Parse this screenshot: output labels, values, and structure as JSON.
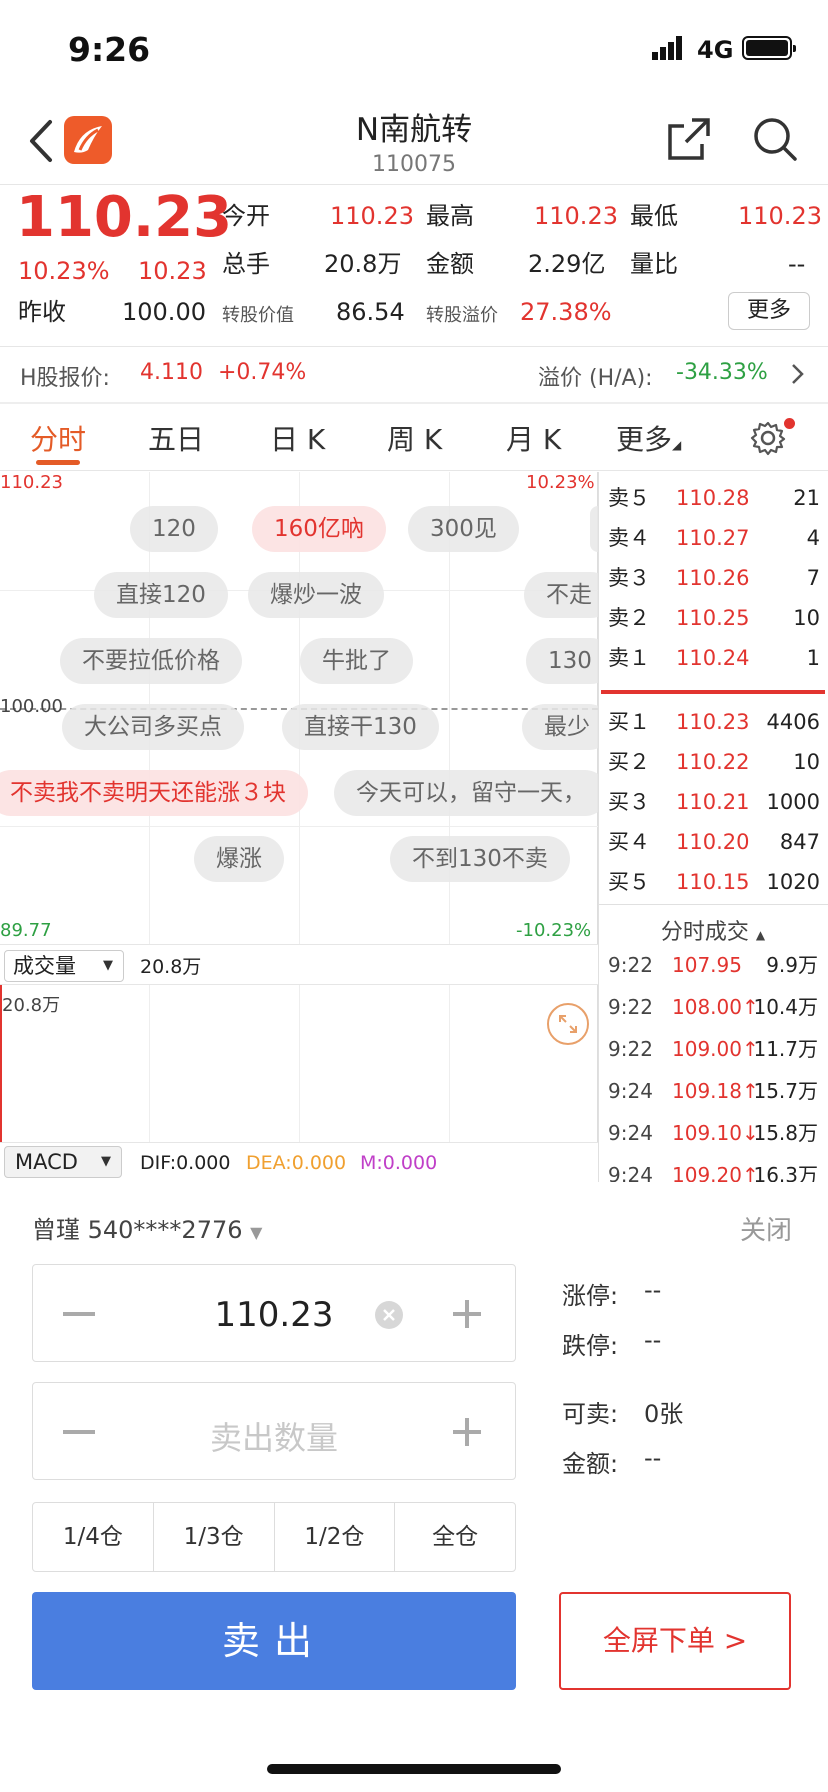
{
  "status_bar": {
    "time": "9:26",
    "network": "4G"
  },
  "nav": {
    "title": "N南航转",
    "code": "110075"
  },
  "quote": {
    "price": "110.23",
    "change_pct": "10.23%",
    "change": "10.23",
    "open_label": "今开",
    "open": "110.23",
    "high_label": "最高",
    "high": "110.23",
    "low_label": "最低",
    "low": "110.23",
    "volume_label": "总手",
    "volume": "20.8万",
    "amount_label": "金额",
    "amount": "2.29亿",
    "ratio_label": "量比",
    "ratio": "--",
    "prev_close_label": "昨收",
    "prev_close": "100.00",
    "conv_value_label": "转股价值",
    "conv_value": "86.54",
    "conv_premium_label": "转股溢价",
    "conv_premium": "27.38%",
    "more_label": "更多"
  },
  "h_share": {
    "label": "H股报价:",
    "price": "4.110",
    "change": "+0.74%",
    "premium_label": "溢价 (H/A):",
    "premium": "-34.33%"
  },
  "tabs": [
    "分时",
    "五日",
    "日 K",
    "周 K",
    "月 K",
    "更多"
  ],
  "chart": {
    "top_left": "110.23",
    "top_right": "10.23%",
    "mid_left": "100.00",
    "bottom_left": "89.77",
    "bottom_right": "-10.23%"
  },
  "bubbles": [
    "120",
    "160亿吶",
    "300见",
    "直接120",
    "爆炒一波",
    "不走",
    "不要拉低价格",
    "牛批了",
    "130",
    "大公司多买点",
    "直接干130",
    "最少",
    "不卖我不卖明天还能涨３块",
    "今天可以，留守一天，",
    "爆涨",
    "不到130不卖"
  ],
  "volume": {
    "selector": "成交量",
    "value": "20.8万",
    "axis_max": "20.8万"
  },
  "macd": {
    "selector": "MACD",
    "dif": "DIF:0.000",
    "dea": "DEA:0.000",
    "m": "M:0.000"
  },
  "order_book": {
    "sells": [
      {
        "label": "卖５",
        "price": "110.28",
        "vol": "21"
      },
      {
        "label": "卖４",
        "price": "110.27",
        "vol": "4"
      },
      {
        "label": "卖３",
        "price": "110.26",
        "vol": "7"
      },
      {
        "label": "卖２",
        "price": "110.25",
        "vol": "10"
      },
      {
        "label": "卖１",
        "price": "110.24",
        "vol": "1"
      }
    ],
    "buys": [
      {
        "label": "买１",
        "price": "110.23",
        "vol": "4406"
      },
      {
        "label": "买２",
        "price": "110.22",
        "vol": "10"
      },
      {
        "label": "买３",
        "price": "110.21",
        "vol": "1000"
      },
      {
        "label": "买４",
        "price": "110.20",
        "vol": "847"
      },
      {
        "label": "买５",
        "price": "110.15",
        "vol": "1020"
      }
    ]
  },
  "trades": {
    "title": "分时成交",
    "rows": [
      {
        "time": "9:22",
        "price": "107.95",
        "vol": "9.9万"
      },
      {
        "time": "9:22",
        "price": "108.00↑",
        "vol": "10.4万"
      },
      {
        "time": "9:22",
        "price": "109.00↑",
        "vol": "11.7万"
      },
      {
        "time": "9:24",
        "price": "109.18↑",
        "vol": "15.7万"
      },
      {
        "time": "9:24",
        "price": "109.10↓",
        "vol": "15.8万"
      },
      {
        "time": "9:24",
        "price": "109.20↑",
        "vol": "16.3万"
      }
    ]
  },
  "order_panel": {
    "account": "曾瑾 540****2776",
    "close": "关闭",
    "price_value": "110.23",
    "qty_placeholder": "卖出数量",
    "limit_up_label": "涨停:",
    "limit_up": "--",
    "limit_down_label": "跌停:",
    "limit_down": "--",
    "sellable_label": "可卖:",
    "sellable": "0张",
    "amount_label": "金额:",
    "amount": "--",
    "positions": [
      "1/4仓",
      "1/3仓",
      "1/2仓",
      "全仓"
    ],
    "sell_button": "卖出",
    "fullscreen_button": "全屏下单 >"
  },
  "colors": {
    "up": "#e2342f",
    "down": "#2ea043",
    "accent": "#e45b27",
    "sell_button": "#4a7ee0"
  }
}
